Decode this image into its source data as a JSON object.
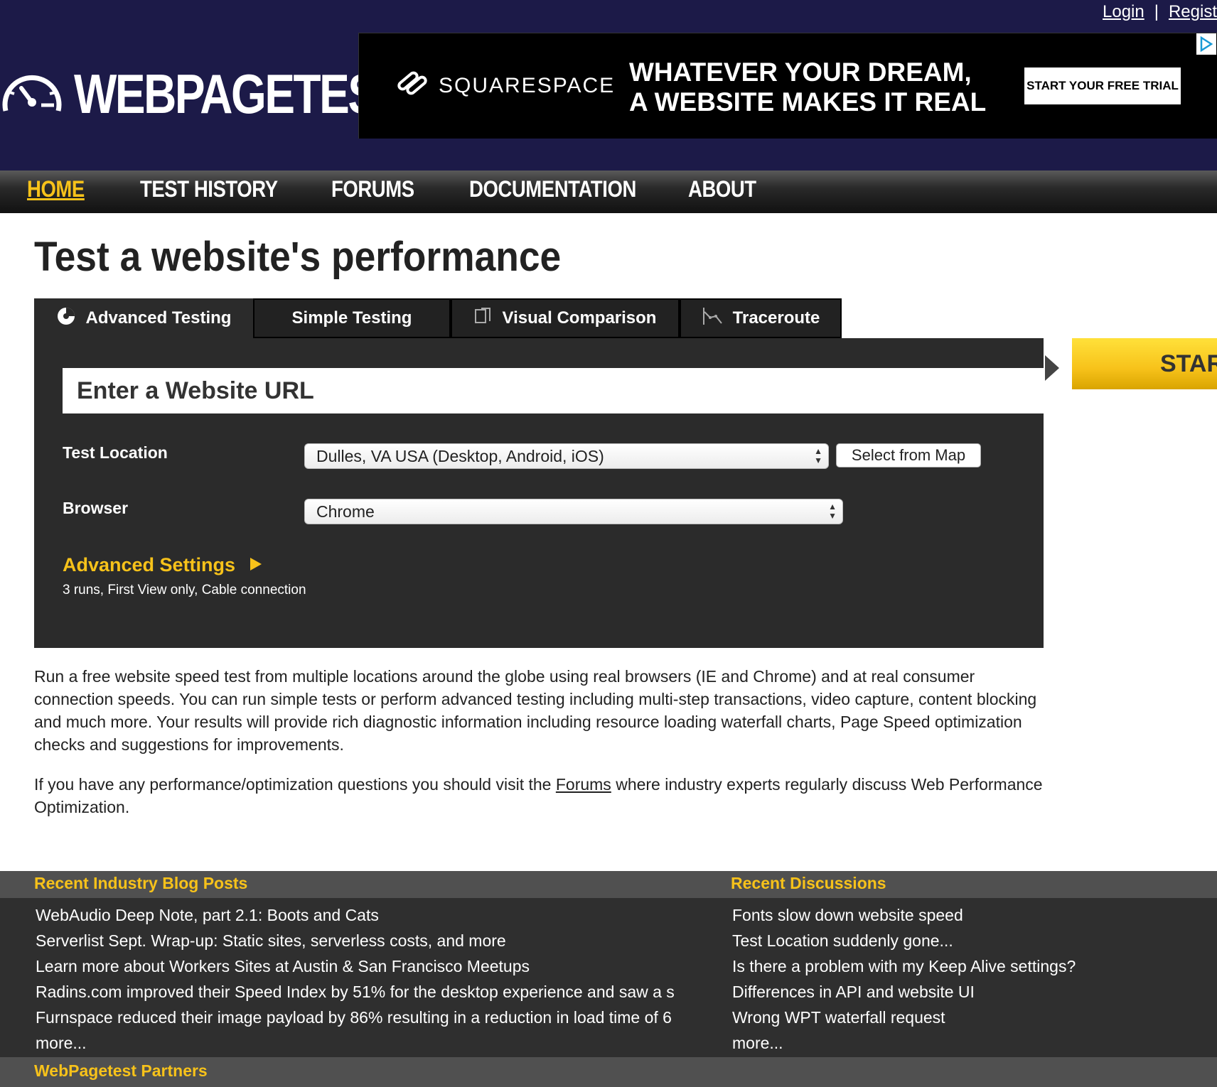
{
  "top_links": {
    "login": "Login",
    "separator": "|",
    "register": "Regist"
  },
  "logo": {
    "text": "WEBPAGETEST"
  },
  "ad": {
    "brand": "SQUARESPACE",
    "headline_line1": "WHATEVER YOUR DREAM,",
    "headline_line2": "A WEBSITE MAKES IT REAL",
    "cta": "START YOUR FREE TRIAL"
  },
  "nav": {
    "home": "HOME",
    "test_history": "TEST HISTORY",
    "forums": "FORUMS",
    "documentation": "DOCUMENTATION",
    "about": "ABOUT"
  },
  "page_title": "Test a website's performance",
  "tabs": {
    "advanced": "Advanced Testing",
    "simple": "Simple Testing",
    "visual": "Visual Comparison",
    "traceroute": "Traceroute"
  },
  "form": {
    "url_placeholder": "Enter a Website URL",
    "test_location_label": "Test Location",
    "test_location_value": "Dulles, VA USA (Desktop, Android, iOS)",
    "select_from_map": "Select from Map",
    "browser_label": "Browser",
    "browser_value": "Chrome",
    "advanced_settings": "Advanced Settings",
    "advanced_summary": "3 runs, First View only, Cable connection",
    "start": "START"
  },
  "description": {
    "p1": "Run a free website speed test from multiple locations around the globe using real browsers (IE and Chrome) and at real consumer connection speeds. You can run simple tests or perform advanced testing including multi-step transactions, video capture, content blocking and much more. Your results will provide rich diagnostic information including resource loading waterfall charts, Page Speed optimization checks and suggestions for improvements.",
    "p2_before": "If you have any performance/optimization questions you should visit the ",
    "p2_link": "Forums",
    "p2_after": " where industry experts regularly discuss Web Performance Optimization."
  },
  "footer": {
    "blog_heading": "Recent Industry Blog Posts",
    "blog_posts": [
      "WebAudio Deep Note, part 2.1: Boots and Cats",
      "Serverlist Sept. Wrap-up: Static sites, serverless costs, and more",
      "Learn more about Workers Sites at Austin & San Francisco Meetups",
      "Radins.com improved their Speed Index by 51% for the desktop experience and saw a s",
      "Furnspace reduced their image payload by 86% resulting in a reduction in load time of 6",
      "more..."
    ],
    "discussions_heading": "Recent Discussions",
    "discussions": [
      "Fonts slow down website speed",
      "Test Location suddenly gone...",
      "Is there a problem with my Keep Alive settings?",
      "Differences in API and website UI",
      "Wrong WPT waterfall request",
      "more..."
    ],
    "partners_heading": "WebPagetest Partners"
  },
  "colors": {
    "header_bg": "#1c1a48",
    "accent_yellow": "#f7c21a",
    "panel_bg": "#2b2b2b",
    "footer_bg": "#2f2f2f"
  }
}
